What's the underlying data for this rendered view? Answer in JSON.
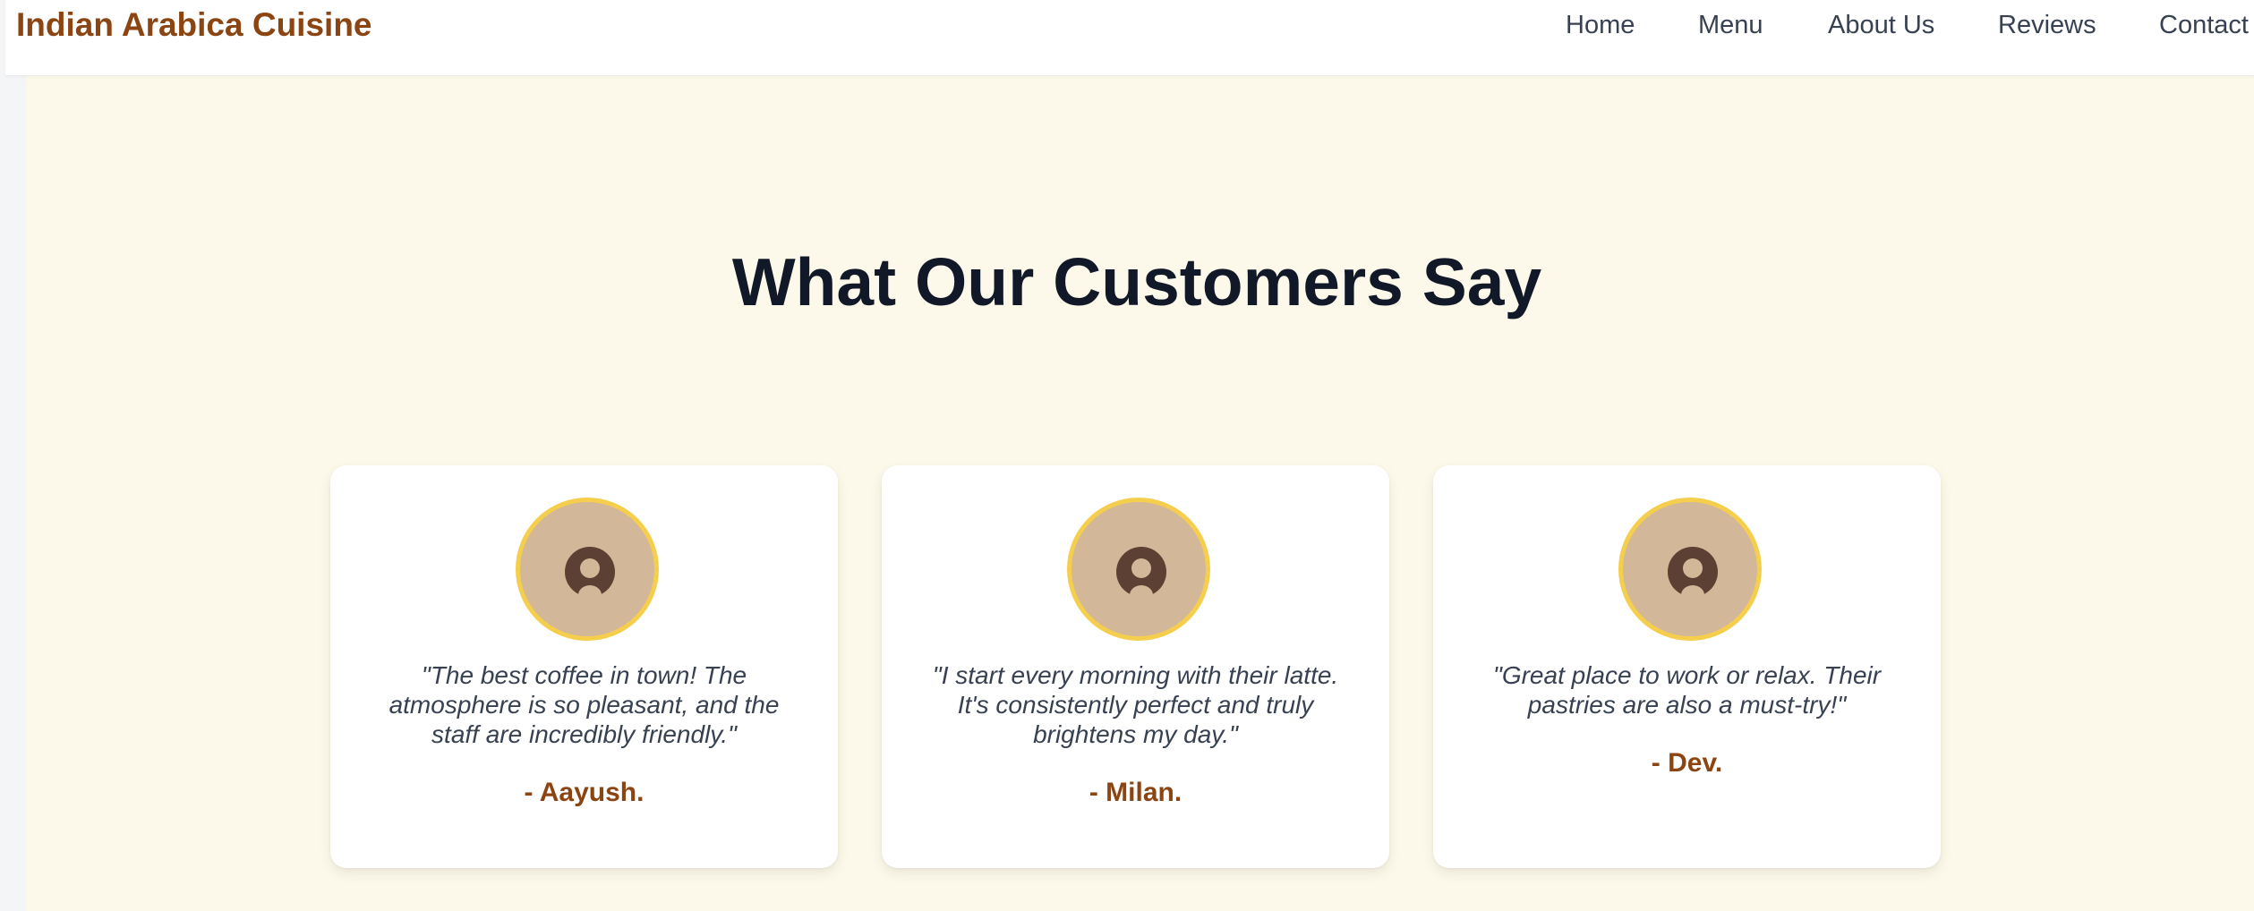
{
  "brand": {
    "name": "Indian Arabica Cuisine"
  },
  "nav": {
    "items": [
      {
        "label": "Home"
      },
      {
        "label": "Menu"
      },
      {
        "label": "About Us"
      },
      {
        "label": "Reviews"
      },
      {
        "label": "Contact"
      }
    ]
  },
  "testimonials": {
    "title": "What Our Customers Say",
    "items": [
      {
        "quote": "\"The best coffee in town! The atmosphere is so pleasant, and the staff are incredibly friendly.\"",
        "author": "- Aayush."
      },
      {
        "quote": "\"I start every morning with their latte. It's consistently perfect and truly brightens my day.\"",
        "author": "- Milan."
      },
      {
        "quote": "\"Great place to work or relax. Their pastries are also a must-try!\"",
        "author": "- Dev."
      }
    ]
  },
  "colors": {
    "brand": "#8b4513",
    "section_background": "#fdf9ea",
    "avatar_fill": "#d2b799",
    "avatar_ring": "#f6ce4e",
    "avatar_icon": "#5c4033",
    "heading": "#111827",
    "body_text": "#374151"
  },
  "icons": {
    "avatar": "user-circle-icon"
  }
}
